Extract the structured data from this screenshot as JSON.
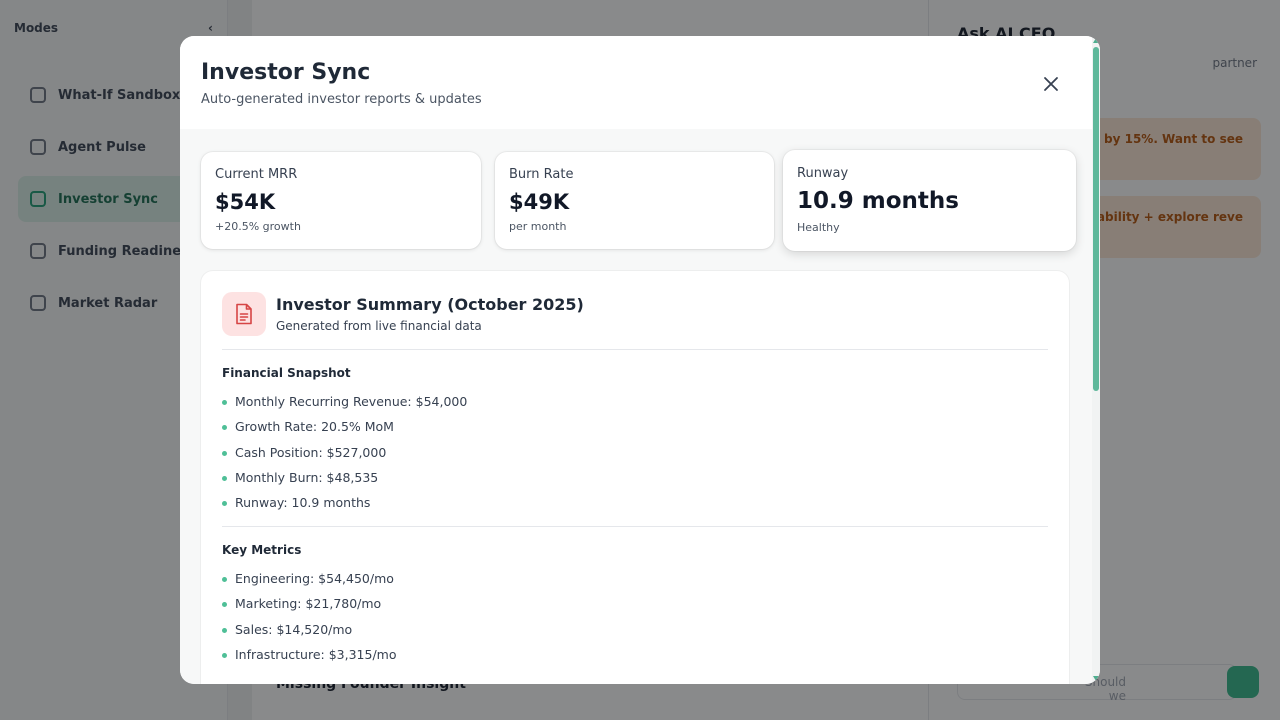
{
  "background": {
    "sidebar": {
      "title": "Modes",
      "items": [
        {
          "label": "What-If Sandbox",
          "icon": "flask-icon"
        },
        {
          "label": "Agent Pulse",
          "icon": "pulse-icon"
        },
        {
          "label": "Investor Sync",
          "icon": "document-icon"
        },
        {
          "label": "Funding Readiness",
          "icon": "chart-icon"
        },
        {
          "label": "Market Radar",
          "icon": "radar-icon"
        }
      ]
    },
    "main": {
      "bottom_heading": "Missing Founder Insight"
    },
    "assistant": {
      "title": "Ask AI CEO",
      "subtitle": "partner",
      "card1": "by 15%. Want to see",
      "card2": "ability + explore reve",
      "input_placeholder": "Should we"
    }
  },
  "modal": {
    "title": "Investor Sync",
    "subtitle": "Auto-generated investor reports & updates",
    "stats": [
      {
        "label": "Current MRR",
        "value": "$54K",
        "note": "+20.5% growth"
      },
      {
        "label": "Burn Rate",
        "value": "$49K",
        "note": "per month"
      },
      {
        "label": "Runway",
        "value": "10.9 months",
        "note": "Healthy"
      }
    ],
    "summary": {
      "title": "Investor Summary (October 2025)",
      "subtitle": "Generated from live financial data",
      "sections": [
        {
          "title": "Financial Snapshot",
          "items": [
            "Monthly Recurring Revenue: $54,000",
            "Growth Rate: 20.5% MoM",
            "Cash Position: $527,000",
            "Monthly Burn: $48,535",
            "Runway: 10.9 months"
          ]
        },
        {
          "title": "Key Metrics",
          "items": [
            "Engineering: $54,450/mo",
            "Marketing: $21,780/mo",
            "Sales: $14,520/mo",
            "Infrastructure: $3,315/mo"
          ]
        }
      ]
    }
  },
  "colors": {
    "accent": "#4fbf97",
    "doc_icon_bg": "#fde2e2",
    "doc_icon_fg": "#d64545"
  }
}
